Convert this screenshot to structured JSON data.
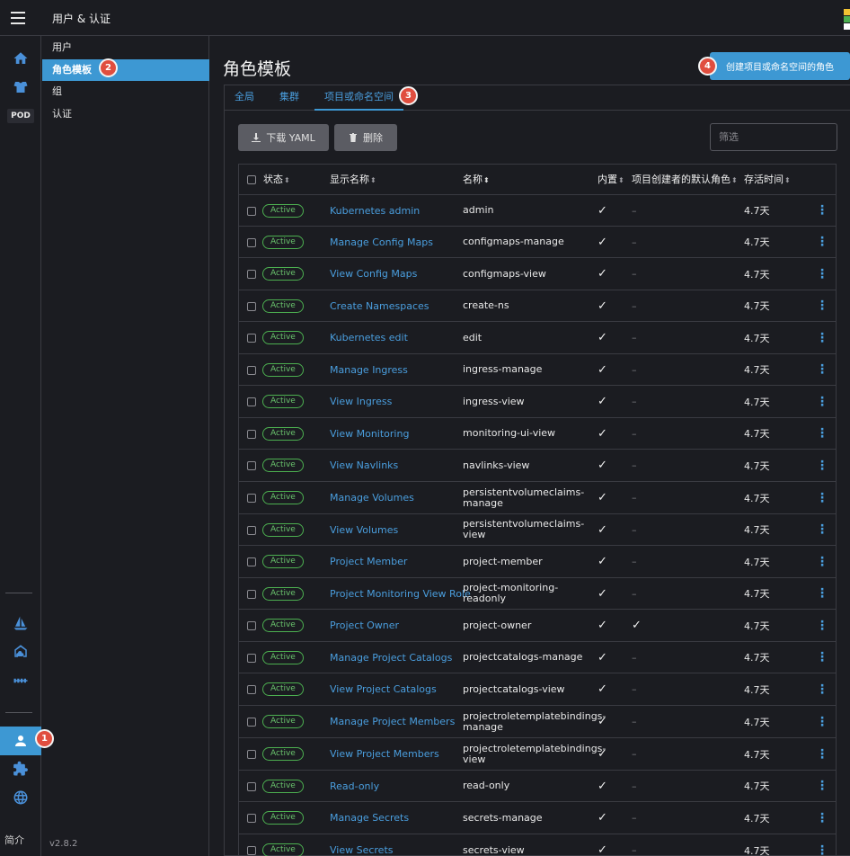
{
  "header": {
    "title": "用户 & 认证"
  },
  "brand_colors": [
    "#f1c232",
    "#4caf50",
    "#ffffff"
  ],
  "rail": {
    "icons": [
      "home-icon",
      "shirt-icon",
      "pod-badge",
      "sailboat-icon",
      "house-cloud-icon",
      "chain-icon",
      "user-icon",
      "puzzle-icon",
      "globe-icon"
    ],
    "pod_label": "POD",
    "footer": "简介"
  },
  "subnav": {
    "items": [
      {
        "label": "用户"
      },
      {
        "label": "角色模板"
      },
      {
        "label": "组"
      },
      {
        "label": "认证"
      }
    ],
    "version": "v2.8.2"
  },
  "callouts": [
    "1",
    "2",
    "3",
    "4"
  ],
  "main": {
    "title": "角色模板",
    "create_button": "创建项目或命名空间的角色",
    "tabs": [
      {
        "label": "全局"
      },
      {
        "label": "集群"
      },
      {
        "label": "项目或命名空间"
      }
    ],
    "download_button": "下载 YAML",
    "delete_button": "删除",
    "filter_placeholder": "筛选"
  },
  "table": {
    "columns": [
      "状态",
      "显示名称",
      "名称",
      "内置",
      "项目创建者的默认角色",
      "存活时间"
    ],
    "rows": [
      {
        "state": "Active",
        "display": "Kubernetes admin",
        "name": "admin",
        "builtin": true,
        "default": false,
        "age": "4.7天"
      },
      {
        "state": "Active",
        "display": "Manage Config Maps",
        "name": "configmaps-manage",
        "builtin": true,
        "default": false,
        "age": "4.7天"
      },
      {
        "state": "Active",
        "display": "View Config Maps",
        "name": "configmaps-view",
        "builtin": true,
        "default": false,
        "age": "4.7天"
      },
      {
        "state": "Active",
        "display": "Create Namespaces",
        "name": "create-ns",
        "builtin": true,
        "default": false,
        "age": "4.7天"
      },
      {
        "state": "Active",
        "display": "Kubernetes edit",
        "name": "edit",
        "builtin": true,
        "default": false,
        "age": "4.7天"
      },
      {
        "state": "Active",
        "display": "Manage Ingress",
        "name": "ingress-manage",
        "builtin": true,
        "default": false,
        "age": "4.7天"
      },
      {
        "state": "Active",
        "display": "View Ingress",
        "name": "ingress-view",
        "builtin": true,
        "default": false,
        "age": "4.7天"
      },
      {
        "state": "Active",
        "display": "View Monitoring",
        "name": "monitoring-ui-view",
        "builtin": true,
        "default": false,
        "age": "4.7天"
      },
      {
        "state": "Active",
        "display": "View Navlinks",
        "name": "navlinks-view",
        "builtin": true,
        "default": false,
        "age": "4.7天"
      },
      {
        "state": "Active",
        "display": "Manage Volumes",
        "name": "persistentvolumeclaims-\nmanage",
        "builtin": true,
        "default": false,
        "age": "4.7天"
      },
      {
        "state": "Active",
        "display": "View Volumes",
        "name": "persistentvolumeclaims-view",
        "builtin": true,
        "default": false,
        "age": "4.7天"
      },
      {
        "state": "Active",
        "display": "Project Member",
        "name": "project-member",
        "builtin": true,
        "default": false,
        "age": "4.7天"
      },
      {
        "state": "Active",
        "display": "Project Monitoring View Role",
        "name": "project-monitoring-readonly",
        "builtin": true,
        "default": false,
        "age": "4.7天"
      },
      {
        "state": "Active",
        "display": "Project Owner",
        "name": "project-owner",
        "builtin": true,
        "default": true,
        "age": "4.7天"
      },
      {
        "state": "Active",
        "display": "Manage Project Catalogs",
        "name": "projectcatalogs-manage",
        "builtin": true,
        "default": false,
        "age": "4.7天"
      },
      {
        "state": "Active",
        "display": "View Project Catalogs",
        "name": "projectcatalogs-view",
        "builtin": true,
        "default": false,
        "age": "4.7天"
      },
      {
        "state": "Active",
        "display": "Manage Project Members",
        "name": "projectroletemplatebindings-\nmanage",
        "builtin": true,
        "default": false,
        "age": "4.7天"
      },
      {
        "state": "Active",
        "display": "View Project Members",
        "name": "projectroletemplatebindings-\nview",
        "builtin": true,
        "default": false,
        "age": "4.7天"
      },
      {
        "state": "Active",
        "display": "Read-only",
        "name": "read-only",
        "builtin": true,
        "default": false,
        "age": "4.7天"
      },
      {
        "state": "Active",
        "display": "Manage Secrets",
        "name": "secrets-manage",
        "builtin": true,
        "default": false,
        "age": "4.7天"
      },
      {
        "state": "Active",
        "display": "View Secrets",
        "name": "secrets-view",
        "builtin": true,
        "default": false,
        "age": "4.7天"
      }
    ]
  }
}
